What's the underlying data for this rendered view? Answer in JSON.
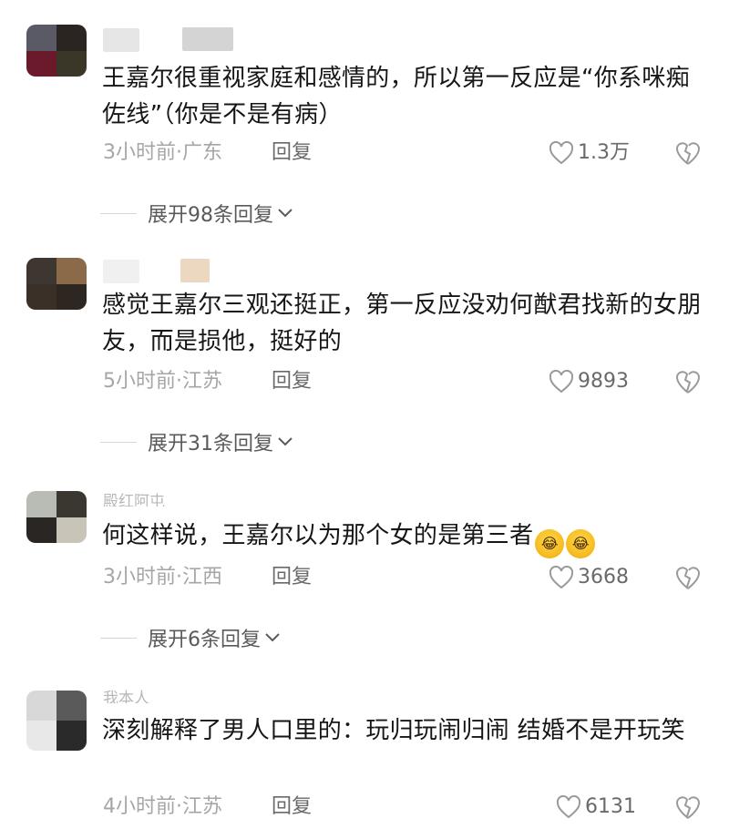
{
  "comments": [
    {
      "username": "",
      "text": "王嘉尔很重视家庭和感情的，所以第一反应是“你系咪痴佐线”（你是不是有病）",
      "meta": "3小时前·广东",
      "reply": "回复",
      "likes": "1.3万",
      "expand": "展开98条回复",
      "avatar_colors": [
        "#5a5a66",
        "#2a2520",
        "#6a1a2a",
        "#3a3628"
      ]
    },
    {
      "username": "",
      "text": "感觉王嘉尔三观还挺正，第一反应没劝何猷君找新的女朋友，而是损他，挺好的",
      "meta": "5小时前·江苏",
      "reply": "回复",
      "likes": "9893",
      "expand": "展开31条回复",
      "avatar_colors": [
        "#3e3630",
        "#8a6a48",
        "#3a3028",
        "#2e2620"
      ]
    },
    {
      "username": "殿红阿屯",
      "text": "何这样说，王嘉尔以为那个女的是第三者",
      "emojis": [
        "😂",
        "😂"
      ],
      "meta": "3小时前·江西",
      "reply": "回复",
      "likes": "3668",
      "expand": "展开6条回复",
      "avatar_colors": [
        "#b8bcb4",
        "#3a3630",
        "#2a2624",
        "#c8c4b8"
      ]
    },
    {
      "username": "我本人",
      "text": "深刻解释了男人口里的：玩归玩闹归闹 结婚不是开玩笑",
      "meta": "4小时前·江苏",
      "reply": "回复",
      "likes": "6131",
      "avatar_colors": [
        "#d8d8d8",
        "#5a5a5a",
        "#e8e8e8",
        "#2a2a2a"
      ]
    }
  ],
  "icons": {
    "like": "heart-outline-icon",
    "dislike": "broken-heart-icon",
    "expand": "chevron-down-icon"
  }
}
